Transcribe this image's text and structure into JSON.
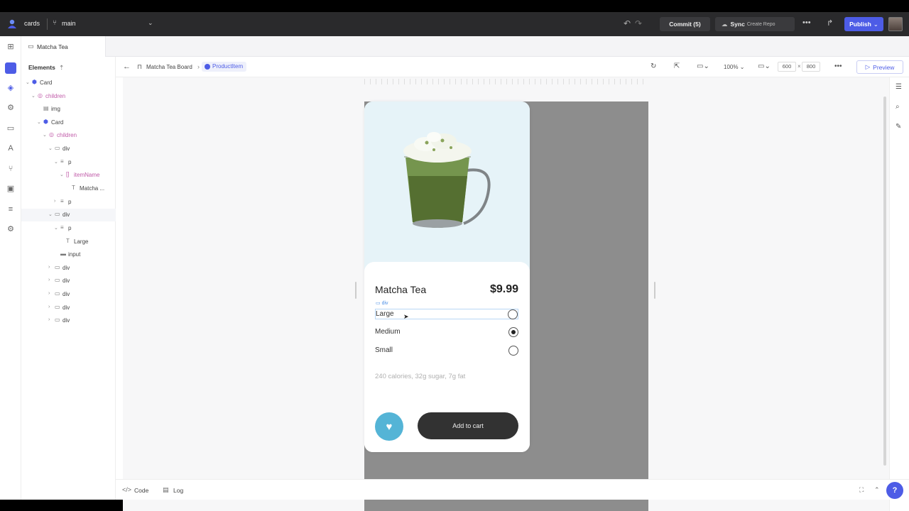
{
  "topbar": {
    "project": "cards",
    "branch": "main",
    "commit_label": "Commit (5)",
    "sync_label": "Sync",
    "sync_sub": "Create Repo",
    "publish_label": "Publish"
  },
  "tabs": [
    {
      "label": "Matcha Tea"
    }
  ],
  "elements_panel": {
    "title": "Elements",
    "tree": [
      {
        "label": "Card"
      },
      {
        "label": "children"
      },
      {
        "label": "img"
      },
      {
        "label": "Card"
      },
      {
        "label": "children"
      },
      {
        "label": "div"
      },
      {
        "label": "p"
      },
      {
        "label": "itemName"
      },
      {
        "label": "Matcha ..."
      },
      {
        "label": "p"
      },
      {
        "label": "div"
      },
      {
        "label": "p"
      },
      {
        "label": "Large"
      },
      {
        "label": "input"
      },
      {
        "label": "div"
      },
      {
        "label": "div"
      },
      {
        "label": "div"
      },
      {
        "label": "div"
      },
      {
        "label": "div"
      }
    ]
  },
  "canvas_header": {
    "board": "Matcha Tea Board",
    "item": "ProductItem",
    "zoom": "100%",
    "width": "600",
    "height": "800",
    "times": "×",
    "preview_label": "Preview"
  },
  "product": {
    "name": "Matcha Tea",
    "price": "$9.99",
    "div_tag": "div",
    "options": [
      {
        "label": "Large",
        "selected": false
      },
      {
        "label": "Medium",
        "selected": true
      },
      {
        "label": "Small",
        "selected": false
      }
    ],
    "meta": "240 calories, 32g sugar, 7g fat",
    "cart_label": "Add to cart"
  },
  "bottombar": {
    "code_label": "Code",
    "log_label": "Log",
    "help_label": "?"
  },
  "colors": {
    "accent": "#4d5ce6",
    "favorite": "#54b4d6",
    "cart": "#323232",
    "image_bg": "#e6f3f8"
  }
}
